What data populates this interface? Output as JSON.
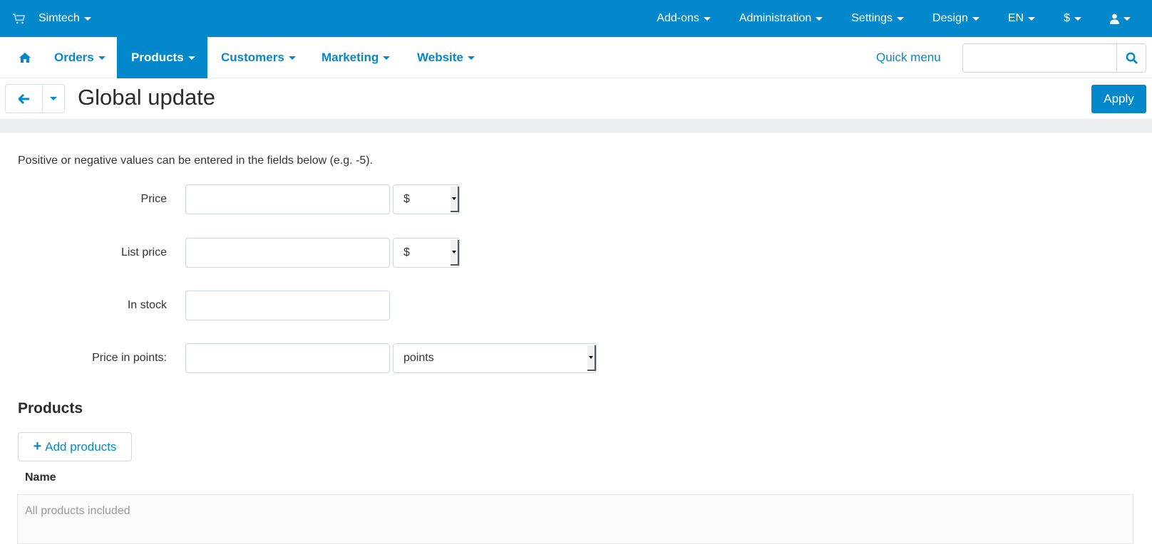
{
  "topbar": {
    "brand": "Simtech",
    "menu": [
      {
        "label": "Add-ons"
      },
      {
        "label": "Administration"
      },
      {
        "label": "Settings"
      },
      {
        "label": "Design"
      },
      {
        "label": "EN"
      },
      {
        "label": "$"
      }
    ],
    "user_icon": "user-icon"
  },
  "nav": {
    "home_icon": "home-icon",
    "items": [
      {
        "label": "Orders",
        "active": false
      },
      {
        "label": "Products",
        "active": true
      },
      {
        "label": "Customers",
        "active": false
      },
      {
        "label": "Marketing",
        "active": false
      },
      {
        "label": "Website",
        "active": false
      }
    ],
    "quick_menu": "Quick menu",
    "search_value": "",
    "search_placeholder": ""
  },
  "titlebar": {
    "title": "Global update",
    "apply_label": "Apply"
  },
  "form": {
    "hint": "Positive or negative values can be entered in the fields below (e.g. -5).",
    "fields": [
      {
        "label": "Price",
        "value": "",
        "select": "$"
      },
      {
        "label": "List price",
        "value": "",
        "select": "$"
      },
      {
        "label": "In stock",
        "value": ""
      },
      {
        "label": "Price in points:",
        "value": "",
        "select": "points"
      }
    ]
  },
  "products": {
    "heading": "Products",
    "add_label": "Add products",
    "column_name": "Name",
    "empty_text": "All products included"
  },
  "colors": {
    "accent": "#0388cc",
    "strip": "#eceff1"
  }
}
